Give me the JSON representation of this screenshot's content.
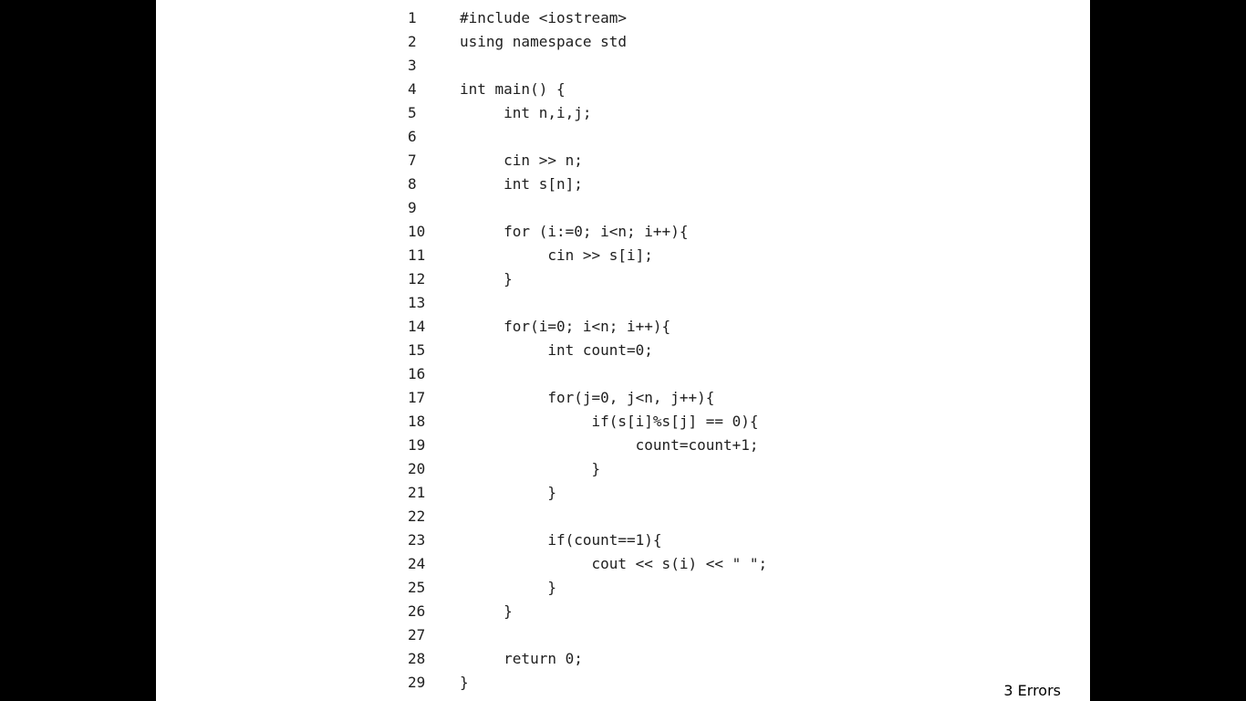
{
  "code_lines": [
    {
      "number": "1",
      "text": "#include <iostream>"
    },
    {
      "number": "2",
      "text": "using namespace std"
    },
    {
      "number": "3",
      "text": ""
    },
    {
      "number": "4",
      "text": "int main() {"
    },
    {
      "number": "5",
      "text": "     int n,i,j;"
    },
    {
      "number": "6",
      "text": ""
    },
    {
      "number": "7",
      "text": "     cin >> n;"
    },
    {
      "number": "8",
      "text": "     int s[n];"
    },
    {
      "number": "9",
      "text": ""
    },
    {
      "number": "10",
      "text": "     for (i:=0; i<n; i++){"
    },
    {
      "number": "11",
      "text": "          cin >> s[i];"
    },
    {
      "number": "12",
      "text": "     }"
    },
    {
      "number": "13",
      "text": ""
    },
    {
      "number": "14",
      "text": "     for(i=0; i<n; i++){"
    },
    {
      "number": "15",
      "text": "          int count=0;"
    },
    {
      "number": "16",
      "text": ""
    },
    {
      "number": "17",
      "text": "          for(j=0, j<n, j++){"
    },
    {
      "number": "18",
      "text": "               if(s[i]%s[j] == 0){"
    },
    {
      "number": "19",
      "text": "                    count=count+1;"
    },
    {
      "number": "20",
      "text": "               }"
    },
    {
      "number": "21",
      "text": "          }"
    },
    {
      "number": "22",
      "text": ""
    },
    {
      "number": "23",
      "text": "          if(count==1){"
    },
    {
      "number": "24",
      "text": "               cout << s(i) << \" \";"
    },
    {
      "number": "25",
      "text": "          }"
    },
    {
      "number": "26",
      "text": "     }"
    },
    {
      "number": "27",
      "text": ""
    },
    {
      "number": "28",
      "text": "     return 0;"
    },
    {
      "number": "29",
      "text": "}"
    }
  ],
  "footer_note": "3 Errors",
  "colors": {
    "background": "#000000",
    "slide": "#ffffff",
    "code_text": "#202020"
  }
}
